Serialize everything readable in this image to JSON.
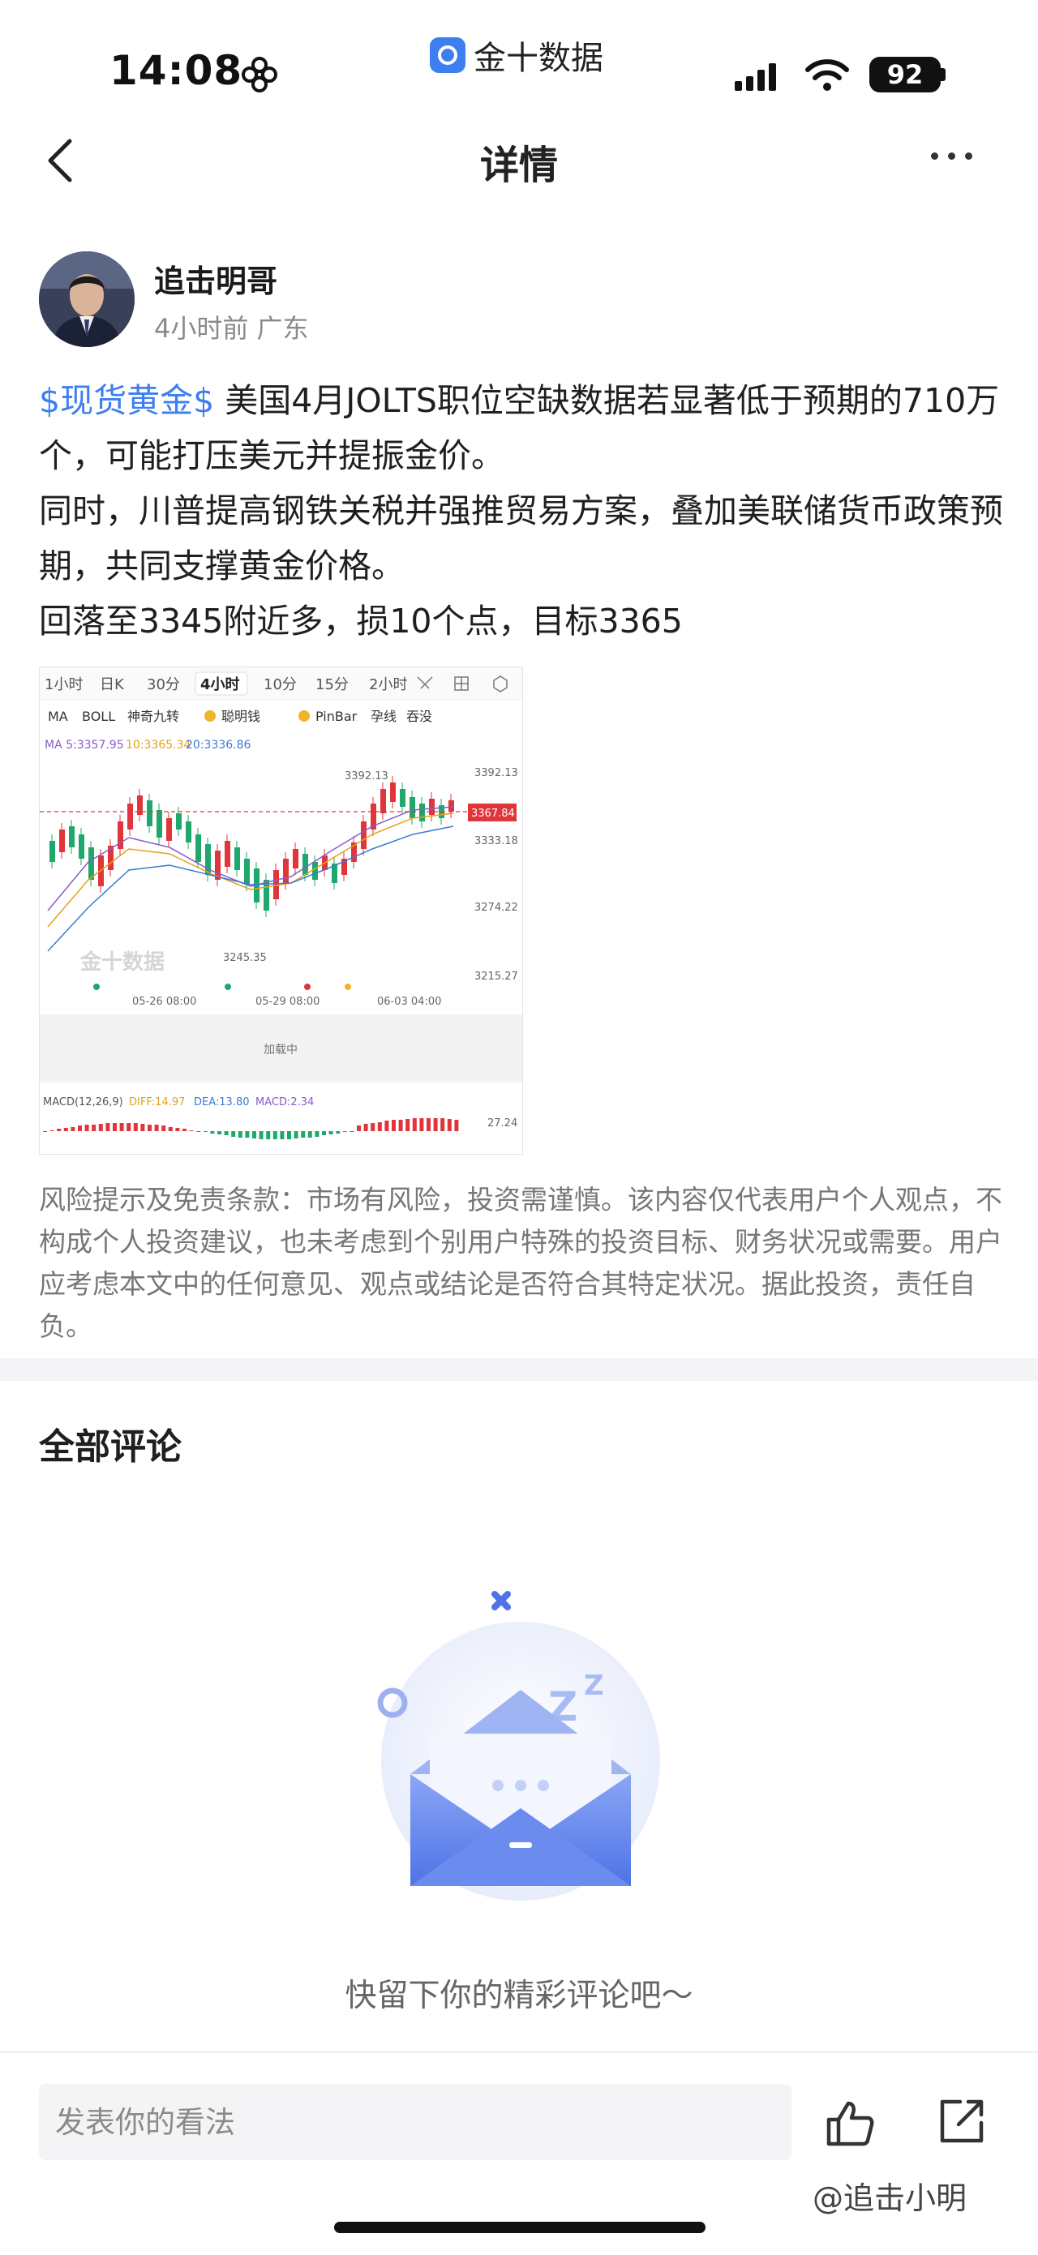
{
  "status": {
    "time": "14:08",
    "app_name": "金十数据",
    "battery": "92"
  },
  "nav": {
    "title": "详情"
  },
  "author": {
    "name": "追击明哥",
    "meta": "4小时前 广东"
  },
  "post": {
    "tag": "$现货黄金$",
    "line1": " 美国4月JOLTS职位空缺数据若显著低于预期的710万个，可能打压美元并提振金价。",
    "line2": "同时，川普提高钢铁关税并强推贸易方案，叠加美联储货币政策预期，共同支撑黄金价格。",
    "line3": "回落至3345附近多，损10个点，目标3365"
  },
  "chart_image": {
    "tabs": [
      "1小时",
      "日K",
      "30分",
      "4小时",
      "10分",
      "15分",
      "2小时"
    ],
    "active_tab": "4小时",
    "indicators": [
      "MA",
      "BOLL",
      "神奇九转",
      "聪明钱",
      "PinBar",
      "孕线",
      "吞没"
    ],
    "ma_values": [
      "MA 5:3357.95",
      "10:3365.34",
      "20:3336.86"
    ],
    "price_levels": [
      "3392.13",
      "3333.18",
      "3274.22",
      "3215.27"
    ],
    "current_price": "3367.84",
    "high_label": "3392.13",
    "low_label": "3245.35",
    "dates": [
      "05-26 08:00",
      "05-29 08:00",
      "06-03 04:00"
    ],
    "loading": "加载中",
    "macd": [
      "MACD(12,26,9)",
      "DIFF:14.97",
      "DEA:13.80",
      "MACD:2.34"
    ],
    "macd_level": "27.24",
    "watermark": "金十数据"
  },
  "disclaimer": "风险提示及免责条款：市场有风险，投资需谨慎。该内容仅代表用户个人观点，不构成个人投资建议，也未考虑到个别用户特殊的投资目标、财务状况或需要。用户应考虑本文中的任何意见、观点或结论是否符合其特定状况。据此投资，责任自负。",
  "comments": {
    "title": "全部评论",
    "empty_text": "快留下你的精彩评论吧～"
  },
  "bottom": {
    "input_placeholder": "发表你的看法",
    "watermark": "@追击小明"
  },
  "colors": {
    "accent": "#3d7ef0",
    "up": "#e0353b",
    "down": "#1fa86b"
  },
  "icons": [
    "back-icon",
    "more-icon",
    "like-icon",
    "share-icon",
    "wifi-icon",
    "signal-icon"
  ]
}
